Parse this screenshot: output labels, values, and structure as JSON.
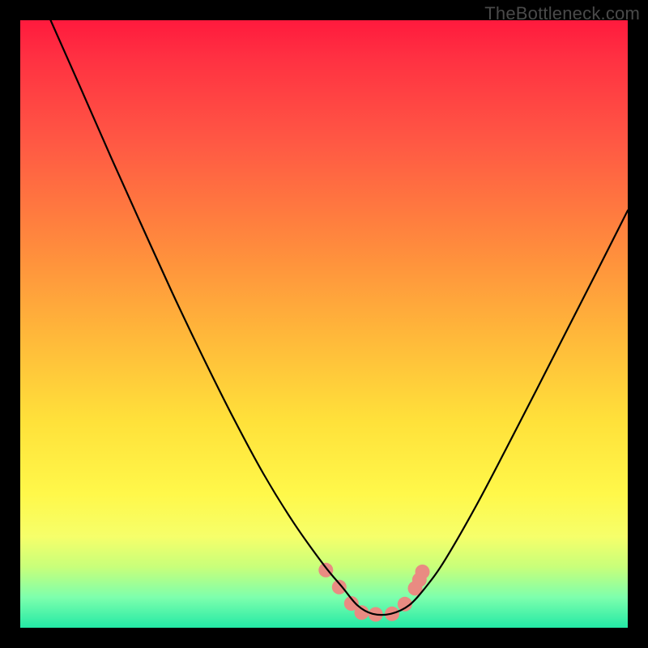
{
  "watermark": "TheBottleneck.com",
  "chart_data": {
    "type": "line",
    "title": "",
    "xlabel": "",
    "ylabel": "",
    "xlim": [
      0,
      1
    ],
    "ylim": [
      0,
      1
    ],
    "notes": "Axes have no visible tick labels; x and y are normalized to [0,1]. y represents bottleneck severity (1 = worst/red top, 0 = best/green bottom). Background is a vertical red→yellow→green gradient. The black curve is a V-shaped bottleneck profile with its minimum near x≈0.58 and a small flat segment at the base.",
    "series": [
      {
        "name": "bottleneck-curve",
        "color": "#000000",
        "x": [
          0.05,
          0.1,
          0.15,
          0.2,
          0.25,
          0.3,
          0.35,
          0.4,
          0.45,
          0.5,
          0.53,
          0.555,
          0.58,
          0.61,
          0.64,
          0.67,
          0.7,
          0.75,
          0.8,
          0.85,
          0.9,
          0.95,
          1.0
        ],
        "y": [
          1.0,
          0.887,
          0.773,
          0.662,
          0.552,
          0.447,
          0.347,
          0.254,
          0.173,
          0.103,
          0.067,
          0.037,
          0.023,
          0.023,
          0.037,
          0.07,
          0.113,
          0.2,
          0.295,
          0.392,
          0.49,
          0.588,
          0.687
        ]
      },
      {
        "name": "marker-dots",
        "color": "#e98b82",
        "type": "scatter",
        "x": [
          0.503,
          0.525,
          0.545,
          0.562,
          0.585,
          0.612,
          0.633,
          0.65,
          0.657,
          0.662
        ],
        "y": [
          0.095,
          0.067,
          0.04,
          0.025,
          0.022,
          0.023,
          0.039,
          0.065,
          0.079,
          0.092
        ]
      }
    ]
  },
  "colors": {
    "frame": "#000000",
    "curve": "#000000",
    "dots": "#e98b82",
    "gradient_top": "#ff1a3d",
    "gradient_mid": "#ffe13a",
    "gradient_bottom": "#23e9a5",
    "watermark": "#4a4a4a"
  }
}
